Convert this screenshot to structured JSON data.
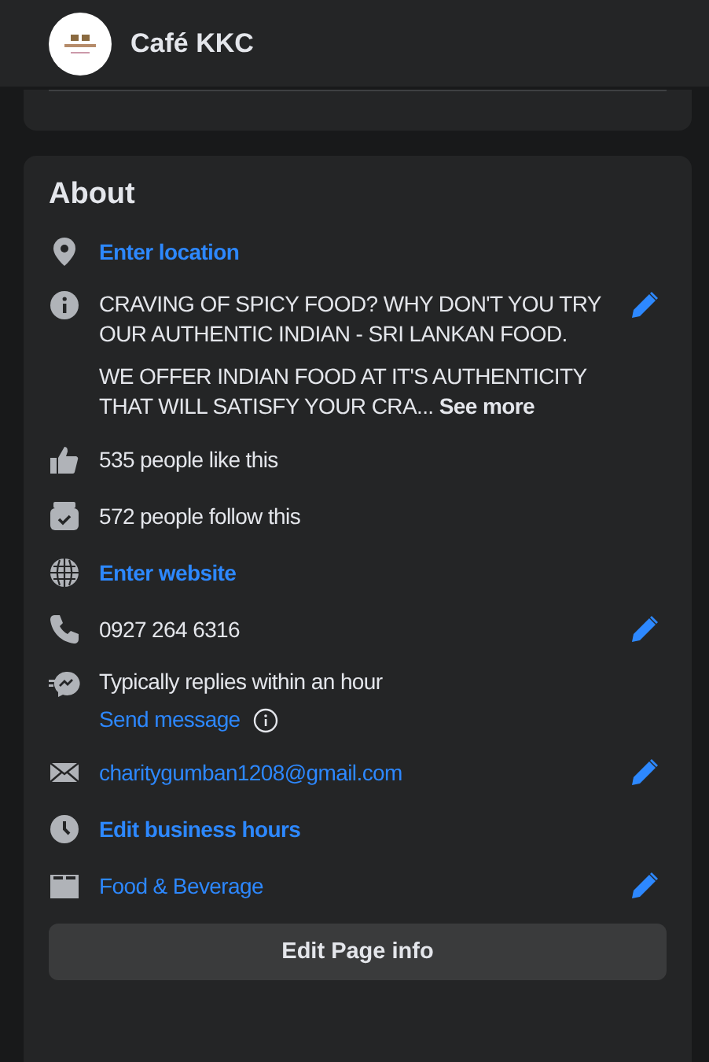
{
  "header": {
    "title": "Café KKC"
  },
  "about": {
    "title": "About",
    "items": [
      {
        "kind": "link",
        "text": "Enter location",
        "editable": false
      },
      {
        "kind": "description",
        "paragraphs": [
          "CRAVING OF SPICY FOOD? WHY DON'T YOU TRY OUR AUTHENTIC INDIAN - SRI LANKAN FOOD.",
          "WE OFFER INDIAN FOOD AT IT'S AUTHENTICITY THAT WILL SATISFY YOUR CRA... **See more**"
        ],
        "editable": true
      },
      {
        "kind": "text",
        "text": "535 people like this",
        "editable": false
      },
      {
        "kind": "text",
        "text": "572 people follow this",
        "editable": false
      },
      {
        "kind": "link",
        "text": "Enter website",
        "editable": false
      },
      {
        "kind": "text",
        "text": "0927 264 6316",
        "editable": true
      },
      {
        "kind": "messenger",
        "text": "Typically replies within an hour",
        "link": "Send message",
        "editable": false
      },
      {
        "kind": "contact",
        "text": "charitygumban1208@gmail.com",
        "editable": true
      },
      {
        "kind": "link",
        "text": "Edit business hours",
        "editable": false
      },
      {
        "kind": "contact",
        "text": "Food & Beverage",
        "editable": true
      }
    ],
    "button": "Edit Page info"
  }
}
